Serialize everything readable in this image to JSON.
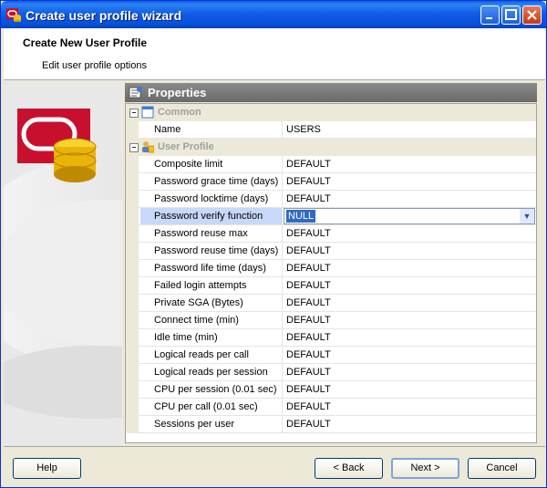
{
  "window": {
    "title": "Create user profile wizard"
  },
  "header": {
    "title": "Create New User Profile",
    "subtitle": "Edit user profile options"
  },
  "properties": {
    "heading": "Properties",
    "categories": [
      {
        "label": "Common",
        "rows": [
          {
            "name": "Name",
            "value": "USERS"
          }
        ]
      },
      {
        "label": "User Profile",
        "rows": [
          {
            "name": "Composite limit",
            "value": "DEFAULT"
          },
          {
            "name": "Password grace time (days)",
            "value": "DEFAULT"
          },
          {
            "name": "Password locktime (days)",
            "value": "DEFAULT"
          },
          {
            "name": "Password verify function",
            "value": "NULL",
            "selected": true
          },
          {
            "name": "Password reuse max",
            "value": "DEFAULT"
          },
          {
            "name": "Password reuse time (days)",
            "value": "DEFAULT"
          },
          {
            "name": "Password life time (days)",
            "value": "DEFAULT"
          },
          {
            "name": "Failed login attempts",
            "value": "DEFAULT"
          },
          {
            "name": "Private SGA (Bytes)",
            "value": "DEFAULT"
          },
          {
            "name": "Connect time (min)",
            "value": "DEFAULT"
          },
          {
            "name": "Idle time (min)",
            "value": "DEFAULT"
          },
          {
            "name": "Logical reads per call",
            "value": "DEFAULT"
          },
          {
            "name": "Logical reads per session",
            "value": "DEFAULT"
          },
          {
            "name": "CPU per session (0.01 sec)",
            "value": "DEFAULT"
          },
          {
            "name": "CPU per call (0.01 sec)",
            "value": "DEFAULT"
          },
          {
            "name": "Sessions per user",
            "value": "DEFAULT"
          }
        ]
      }
    ]
  },
  "buttons": {
    "help": "Help",
    "back": "< Back",
    "next": "Next >",
    "cancel": "Cancel"
  },
  "icons": {
    "app": "oracle-db-icon",
    "props": "properties-icon",
    "common": "common-category-icon",
    "profile": "user-profile-icon",
    "toggle": "collapse-icon"
  },
  "colors": {
    "titlebar": "#0550d9",
    "selection": "#316ac5",
    "accent_red": "#c8102e"
  }
}
